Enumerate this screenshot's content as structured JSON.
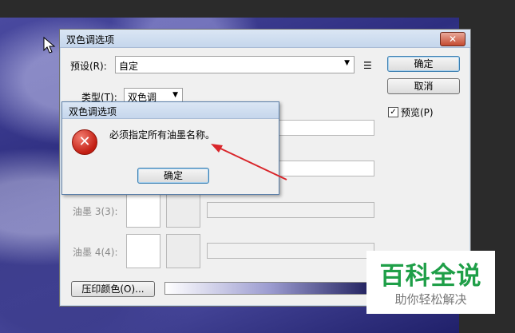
{
  "dialog": {
    "title": "双色调选项",
    "close_glyph": "✕",
    "preset_label": "预设(R):",
    "preset_value": "自定",
    "type_label": "类型(T):",
    "type_value": "双色调",
    "ok_label": "确定",
    "cancel_label": "取消",
    "preview_label": "预览(P)",
    "preview_checked": true,
    "ink3_label": "油墨 3(3):",
    "ink4_label": "油墨 4(4):",
    "overprint_label": "压印颜色(O)..."
  },
  "alert": {
    "title": "双色调选项",
    "message": "必须指定所有油墨名称。",
    "ok_label": "确定",
    "icon": "error-icon"
  },
  "watermark": {
    "main": "百科全说",
    "sub": "助你轻松解决"
  },
  "colors": {
    "error_red": "#c21d12",
    "annotation_arrow": "#d9262b",
    "watermark_green": "#1f9f48"
  }
}
